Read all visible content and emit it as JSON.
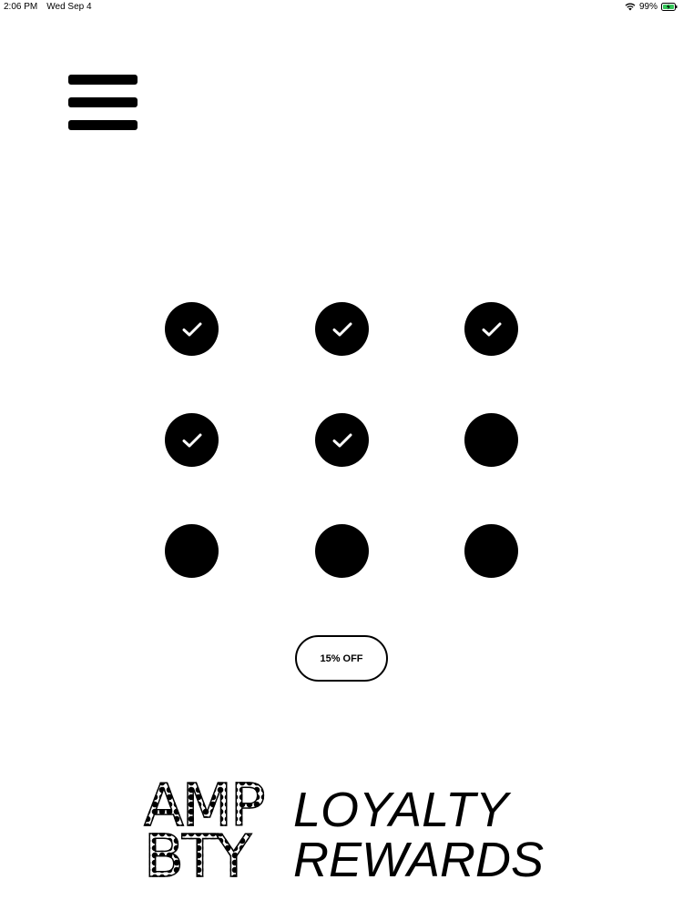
{
  "status_bar": {
    "time": "2:06 PM",
    "date": "Wed Sep 4",
    "battery_percent": "99%",
    "wifi_icon": "wifi-icon",
    "battery_icon": "battery-charging-icon"
  },
  "menu": {
    "icon": "hamburger-menu-icon"
  },
  "stamp_card": {
    "total": 9,
    "completed": 5,
    "stamps": [
      {
        "stamped": true
      },
      {
        "stamped": true
      },
      {
        "stamped": true
      },
      {
        "stamped": true
      },
      {
        "stamped": true
      },
      {
        "stamped": false
      },
      {
        "stamped": false
      },
      {
        "stamped": false
      },
      {
        "stamped": false
      }
    ]
  },
  "reward": {
    "label": "15% OFF"
  },
  "logo": {
    "line1": "AMP",
    "line2": "BTY"
  },
  "program": {
    "title_line1": "LOYALTY",
    "title_line2": "REWARDS"
  },
  "colors": {
    "stamp": "#000000",
    "check": "#ffffff",
    "background": "#ffffff",
    "battery_charge": "#34c759"
  }
}
